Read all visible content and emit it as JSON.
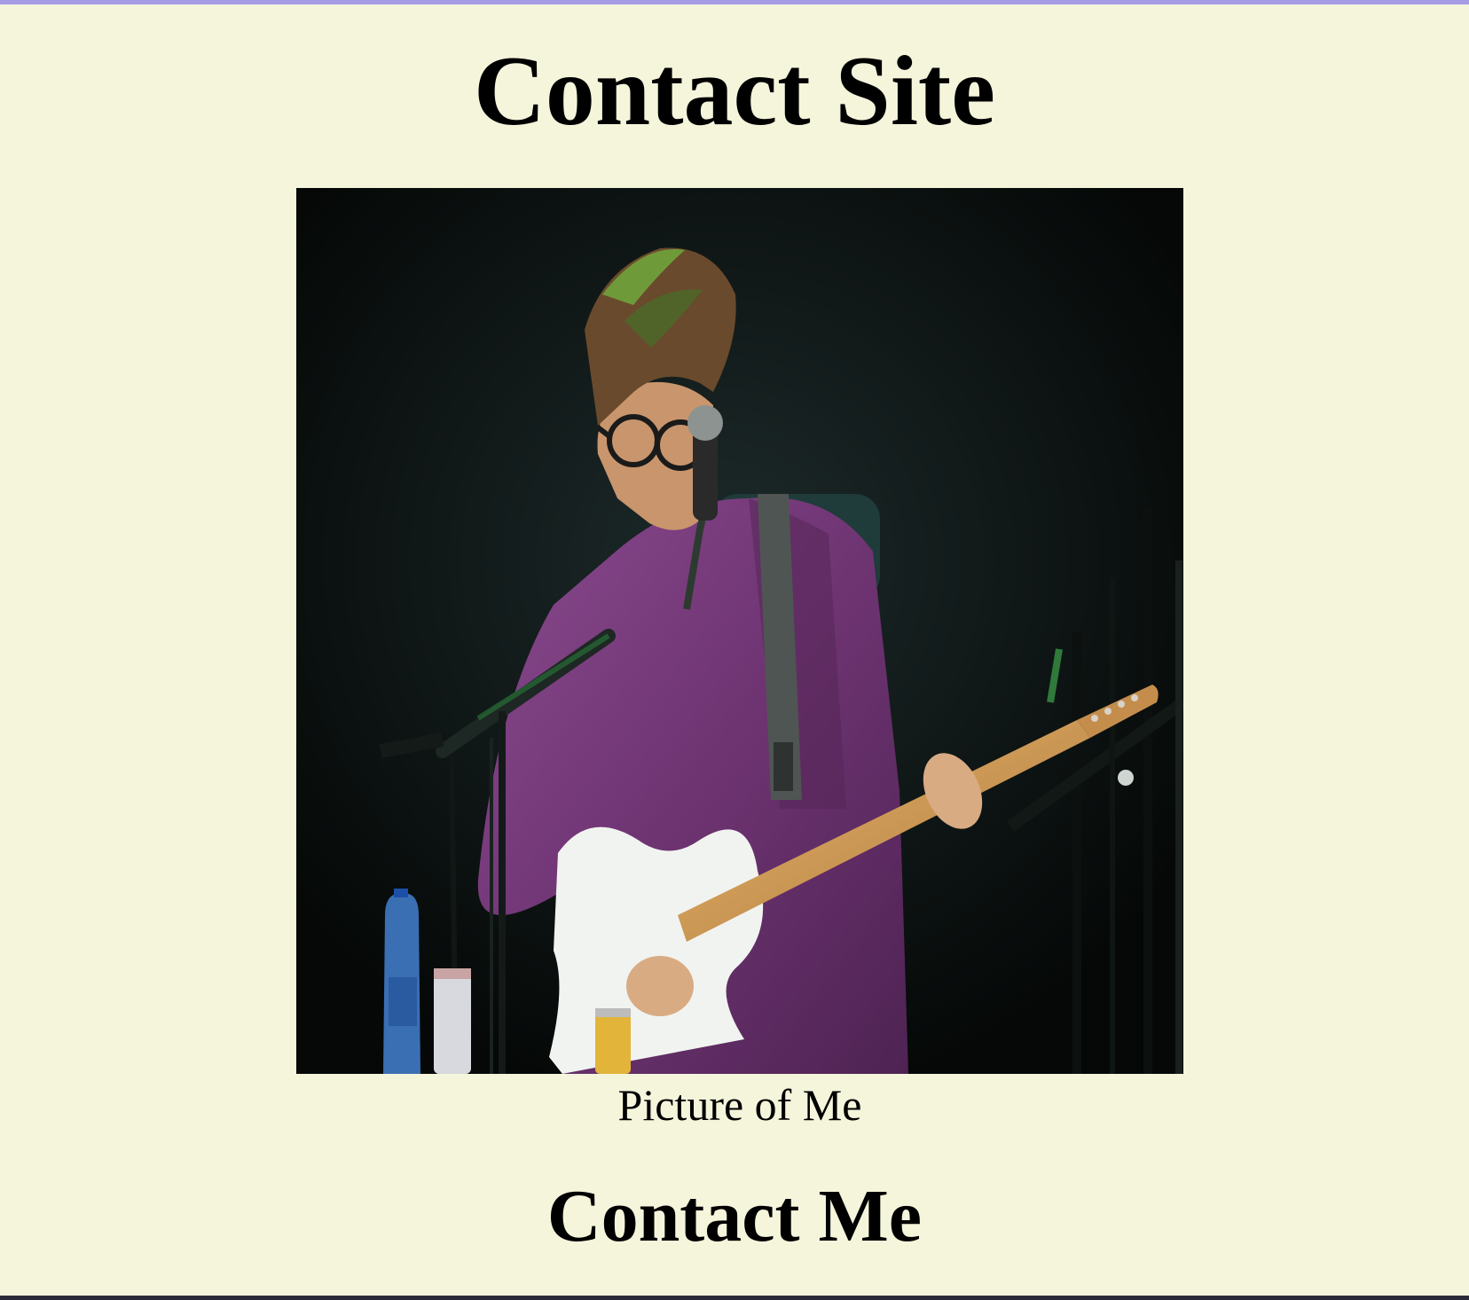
{
  "page": {
    "title": "Contact Site",
    "background_color": "#f5f5dc",
    "accent_color": "#a59be6"
  },
  "figure": {
    "image_alt": "Picture of Me",
    "caption": "Picture of Me"
  },
  "contact_section": {
    "heading": "Contact Me"
  }
}
